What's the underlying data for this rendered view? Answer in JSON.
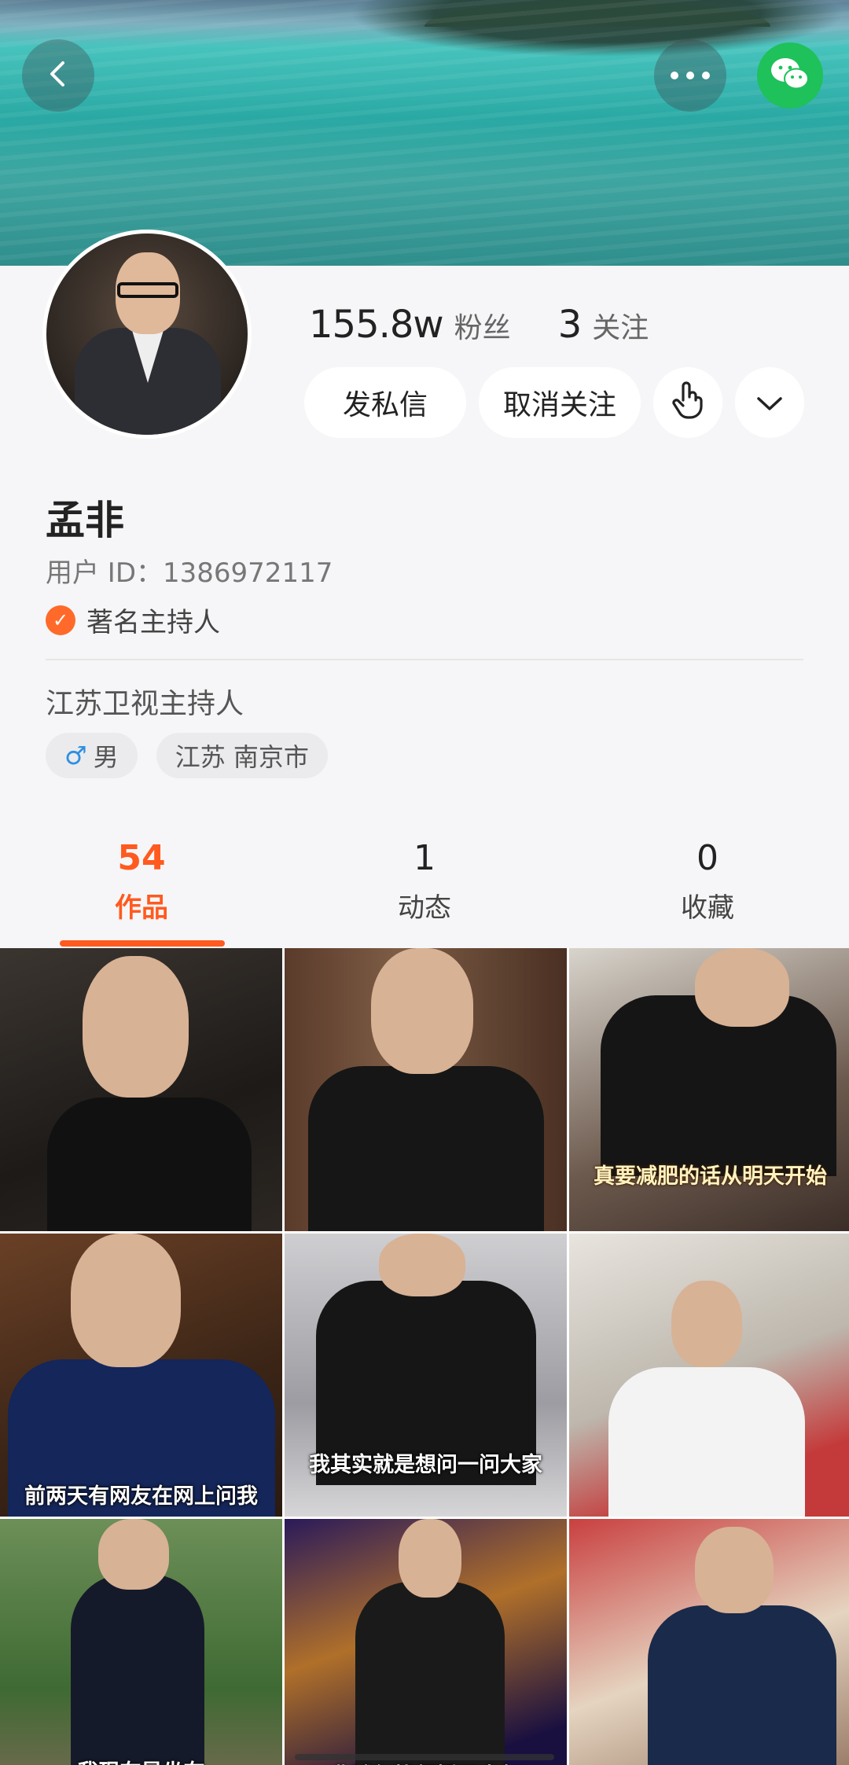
{
  "header": {
    "back_icon": "chevron-left-icon",
    "more_icon": "more-horizontal-icon",
    "share_icon": "wechat-icon",
    "colors": {
      "wechat": "#1fc15a",
      "accent": "#ff5a1f"
    }
  },
  "profile": {
    "followers_count": "155.8w",
    "followers_label": "粉丝",
    "following_count": "3",
    "following_label": "关注",
    "message_button": "发私信",
    "unfollow_button": "取消关注",
    "name": "孟非",
    "user_id": "用户 ID：1386972117",
    "verification": "著名主持人",
    "bio": "江苏卫视主持人",
    "gender": "男",
    "location": "江苏 南京市"
  },
  "tabs": [
    {
      "count": "54",
      "label": "作品"
    },
    {
      "count": "1",
      "label": "动态"
    },
    {
      "count": "0",
      "label": "收藏"
    }
  ],
  "videos": [
    {
      "caption": ""
    },
    {
      "caption": ""
    },
    {
      "caption": "真要减肥的话从明天开始"
    },
    {
      "caption": "前两天有网友在网上问我"
    },
    {
      "caption": "我其实就是想问一问大家"
    },
    {
      "caption": ""
    },
    {
      "caption": "我现在是坐在"
    },
    {
      "caption": "非诚勿扰都播了十年"
    },
    {
      "caption": ""
    }
  ]
}
